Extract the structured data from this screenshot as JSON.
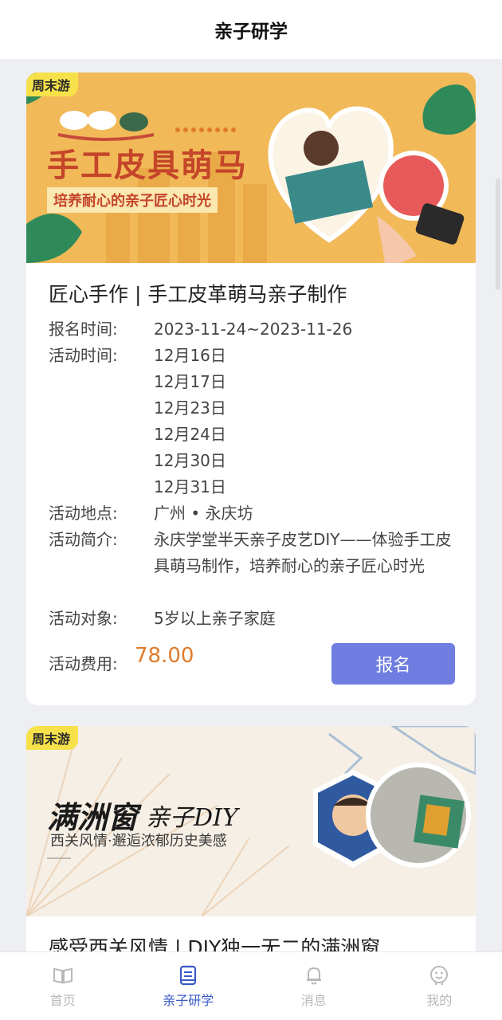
{
  "header": {
    "title": "亲子研学"
  },
  "colors": {
    "accent": "#6f7de0",
    "price": "#e07b2a",
    "active_tab": "#3a5ac7",
    "badge": "#f6e14a"
  },
  "cards": [
    {
      "badge": "周末游",
      "banner_title": "手工皮具萌马",
      "banner_subtitle": "培养耐心的亲子匠心时光",
      "title": "匠心手作 | 手工皮革萌马亲子制作",
      "register_label": "报名时间:",
      "register_value": "2023-11-24~2023-11-26",
      "activity_label": "活动时间:",
      "activity_dates": [
        "12月16日",
        "12月17日",
        "12月23日",
        "12月24日",
        "12月30日",
        "12月31日"
      ],
      "location_label": "活动地点:",
      "location_value": "广州 • 永庆坊",
      "intro_label": "活动简介:",
      "intro_value": "永庆学堂半天亲子皮艺DIY——体验手工皮具萌马制作，培养耐心的亲子匠心时光",
      "target_label": "活动对象:",
      "target_value": "5岁以上亲子家庭",
      "fee_label": "活动费用:",
      "fee_value": "78.00",
      "signup_label": "报名"
    },
    {
      "badge": "周末游",
      "banner_title": "满洲窗",
      "banner_title2": "亲子DIY",
      "banner_subtitle": "西关风情·邂逅浓郁历史美感",
      "title": "感受西关风情 | DIY独一无二的满洲窗"
    }
  ],
  "tabs": [
    {
      "label": "首页",
      "icon": "book-open-icon"
    },
    {
      "label": "亲子研学",
      "icon": "notebook-icon"
    },
    {
      "label": "消息",
      "icon": "bell-icon"
    },
    {
      "label": "我的",
      "icon": "smiley-face-icon"
    }
  ]
}
